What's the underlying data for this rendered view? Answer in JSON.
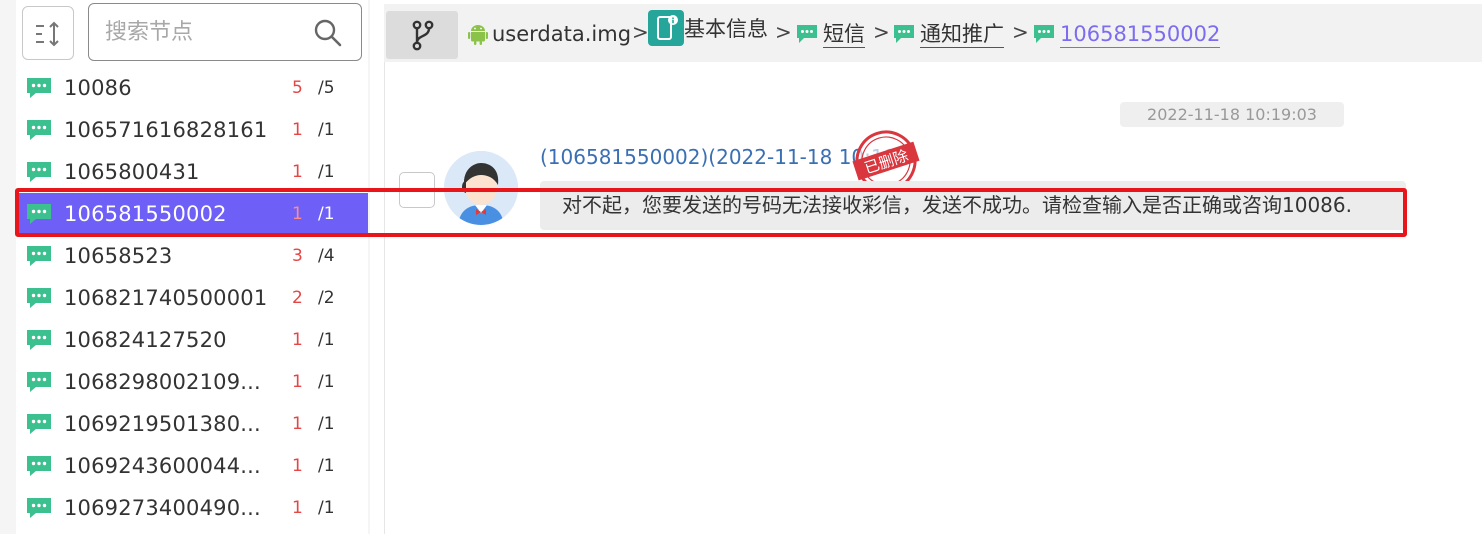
{
  "search": {
    "placeholder": "搜索节点"
  },
  "nodes": [
    {
      "name": "10086",
      "unread": "5",
      "total": "/5",
      "selected": false
    },
    {
      "name": "10657161682816​1",
      "unread": "1",
      "total": "/1",
      "selected": false
    },
    {
      "name": "1065800431",
      "unread": "1",
      "total": "/1",
      "selected": false
    },
    {
      "name": "106581550002",
      "unread": "1",
      "total": "/1",
      "selected": true
    },
    {
      "name": "10658523",
      "unread": "3",
      "total": "/4",
      "selected": false
    },
    {
      "name": "106821740500001",
      "unread": "2",
      "total": "/2",
      "selected": false
    },
    {
      "name": "106824127520",
      "unread": "1",
      "total": "/1",
      "selected": false
    },
    {
      "name": "1068298002109...",
      "unread": "1",
      "total": "/1",
      "selected": false
    },
    {
      "name": "1069219501380...",
      "unread": "1",
      "total": "/1",
      "selected": false
    },
    {
      "name": "1069243600044...",
      "unread": "1",
      "total": "/1",
      "selected": false
    },
    {
      "name": "1069273400490...",
      "unread": "1",
      "total": "/1",
      "selected": false
    }
  ],
  "breadcrumb": {
    "items": [
      {
        "label": "userdata.img",
        "icon": "android-icon"
      },
      {
        "label": "基本信息",
        "icon": "phone-info-icon"
      },
      {
        "label": "短信",
        "icon": "message-icon"
      },
      {
        "label": "通知推广",
        "icon": "message-icon"
      },
      {
        "label": "106581550002",
        "icon": "message-icon"
      }
    ],
    "separator": ">"
  },
  "message": {
    "timestamp": "2022-11-18 10:19:03",
    "header": "(106581550002)(2022-11-18 10:19",
    "stamp_text": "已删除",
    "body": "对不起，您要发送的号码无法接收彩信，发送不成功。请检查输入是否正确或咨询10086."
  },
  "colors": {
    "accent": "#6e5ff7",
    "msg_icon": "#3cc08f",
    "unread": "#e54545",
    "link": "#3a6fb3",
    "highlight_frame": "#e8161a"
  }
}
